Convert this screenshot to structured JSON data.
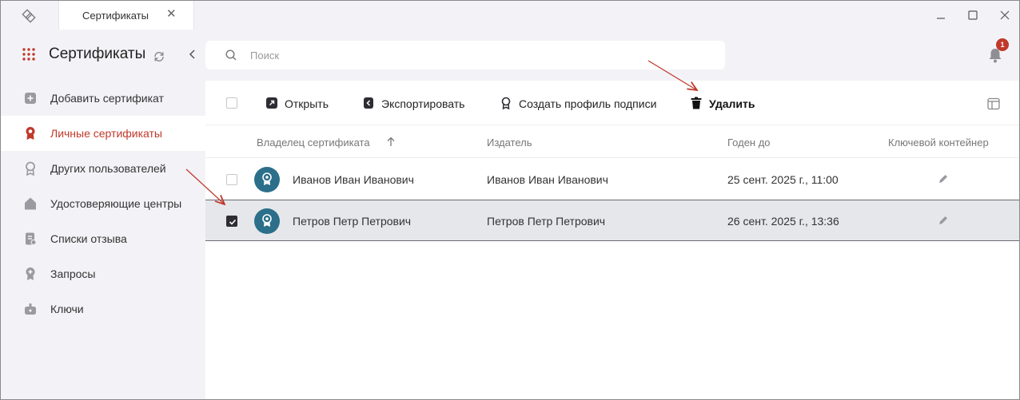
{
  "titlebar": {
    "tab_label": "Сертификаты",
    "tab_close": "✕"
  },
  "sidebar": {
    "title": "Сертификаты",
    "items": [
      {
        "label": "Добавить сертификат",
        "icon": "plus-square-icon"
      },
      {
        "label": "Личные сертификаты",
        "icon": "ribbon-badge-icon",
        "active": true
      },
      {
        "label": "Других пользователей",
        "icon": "badge-outline-icon"
      },
      {
        "label": "Удостоверяющие центры",
        "icon": "home-icon"
      },
      {
        "label": "Списки отзыва",
        "icon": "document-list-icon"
      },
      {
        "label": "Запросы",
        "icon": "badge-request-icon"
      },
      {
        "label": "Ключи",
        "icon": "key-icon"
      }
    ]
  },
  "search": {
    "placeholder": "Поиск"
  },
  "notifications": {
    "count": "1"
  },
  "toolbar": {
    "open_label": "Открыть",
    "export_label": "Экспортировать",
    "create_profile_label": "Создать профиль подписи",
    "delete_label": "Удалить"
  },
  "table": {
    "columns": [
      "Владелец сертификата",
      "Издатель",
      "Годен до",
      "Ключевой контейнер"
    ],
    "rows": [
      {
        "owner": "Иванов Иван Иванович",
        "issuer": "Иванов Иван Иванович",
        "valid_until": "25 сент. 2025 г., 11:00",
        "selected": false
      },
      {
        "owner": "Петров Петр Петрович",
        "issuer": "Петров Петр Петрович",
        "valid_until": "26 сент. 2025 г., 13:36",
        "selected": true
      }
    ]
  },
  "colors": {
    "accent": "#c0392b",
    "avatar": "#2b6f8a",
    "selected_row": "#e6e7eb"
  }
}
